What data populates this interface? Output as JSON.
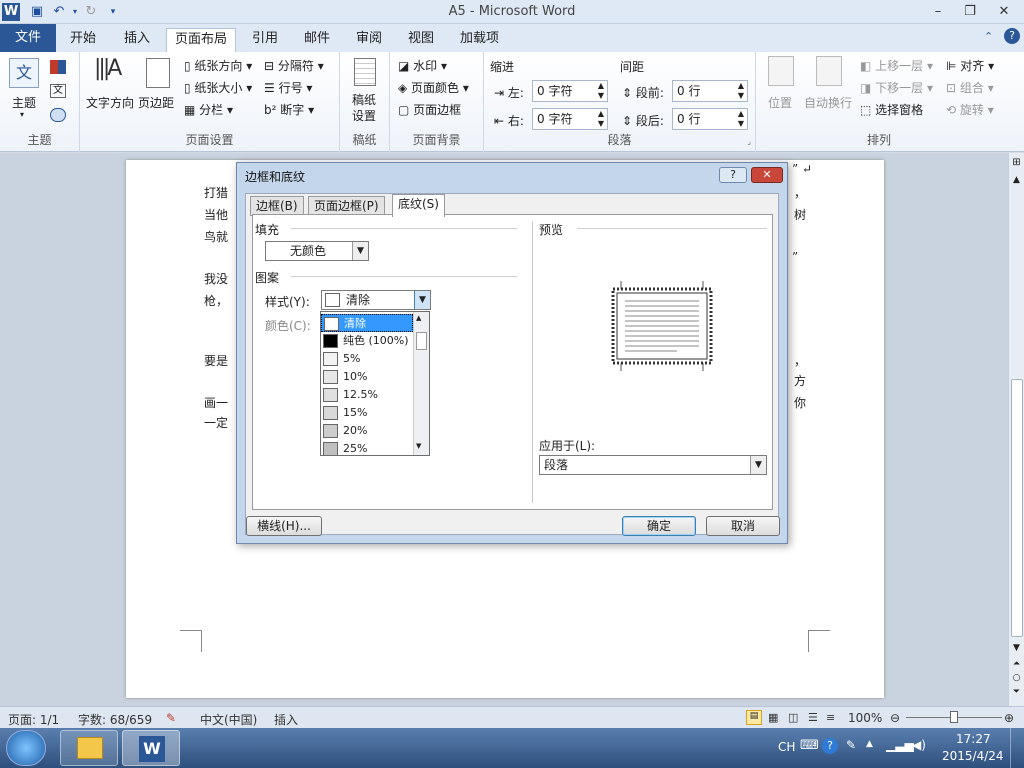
{
  "window": {
    "title": "A5 - Microsoft Word"
  },
  "tabs": [
    "文件",
    "开始",
    "插入",
    "页面布局",
    "引用",
    "邮件",
    "审阅",
    "视图",
    "加载项"
  ],
  "ribbon": {
    "theme": {
      "label": "主题",
      "button": "主题"
    },
    "page_setup": {
      "label": "页面设置",
      "text_direction": "文字方向",
      "margins": "页边距",
      "orientation": "纸张方向",
      "size": "纸张大小",
      "columns": "分栏",
      "breaks": "分隔符",
      "line_numbers": "行号",
      "hyphenation": "断字"
    },
    "draft": {
      "label": "稿纸",
      "button": "稿纸\n设置"
    },
    "background": {
      "label": "页面背景",
      "watermark": "水印",
      "page_color": "页面颜色",
      "page_border": "页面边框"
    },
    "paragraph": {
      "label": "段落",
      "indent": "缩进",
      "spacing": "间距",
      "left": "左:",
      "right": "右:",
      "before": "段前:",
      "after": "段后:",
      "left_val": "0 字符",
      "right_val": "0 字符",
      "before_val": "0 行",
      "after_val": "0 行"
    },
    "arrange": {
      "label": "排列",
      "position": "位置",
      "wrap": "自动换行",
      "bring_forward": "上移一层",
      "send_backward": "下移一层",
      "selection_pane": "选择窗格",
      "align": "对齐",
      "group": "组合",
      "rotate": "旋转"
    }
  },
  "document": {
    "lines": [
      {
        "l": "打猎",
        "r": "，"
      },
      {
        "l": "当他",
        "r": "树"
      },
      {
        "l": "鸟就",
        "r": ""
      },
      {
        "l": "",
        "r": "”"
      },
      {
        "l": "我没",
        "r": ""
      },
      {
        "l": "枪，",
        "r": ""
      },
      {
        "l": "要是",
        "r": "，"
      },
      {
        "l": "画一",
        "r": "方"
      },
      {
        "l": "一定",
        "r": "你"
      }
    ],
    "top_quote": "”"
  },
  "dialog": {
    "title": "边框和底纹",
    "tabs": [
      "边框(B)",
      "页面边框(P)",
      "底纹(S)"
    ],
    "fill_label": "填充",
    "fill_value": "无颜色",
    "pattern_label": "图案",
    "style_label": "样式(Y):",
    "style_value": "清除",
    "color_label": "颜色(C):",
    "preview_label": "预览",
    "apply_label": "应用于(L):",
    "apply_value": "段落",
    "horizontal_btn": "横线(H)...",
    "ok": "确定",
    "cancel": "取消"
  },
  "dropdown_items": [
    {
      "label": "清除",
      "color": "#ffffff"
    },
    {
      "label": "纯色 (100%)",
      "color": "#000000"
    },
    {
      "label": "5%",
      "color": "#f2f2f2"
    },
    {
      "label": "10%",
      "color": "#e6e6e6"
    },
    {
      "label": "12.5%",
      "color": "#e0e0e0"
    },
    {
      "label": "15%",
      "color": "#d9d9d9"
    },
    {
      "label": "20%",
      "color": "#cccccc"
    },
    {
      "label": "25%",
      "color": "#bfbfbf"
    }
  ],
  "status": {
    "page": "页面: 1/1",
    "words": "字数: 68/659",
    "lang": "中文(中国)",
    "insert": "插入",
    "zoom": "100%"
  },
  "taskbar": {
    "ime": "CH",
    "time": "17:27",
    "date": "2015/4/24"
  },
  "colors": {
    "file_tab": "#2b5797",
    "selection": "#3399ff"
  }
}
